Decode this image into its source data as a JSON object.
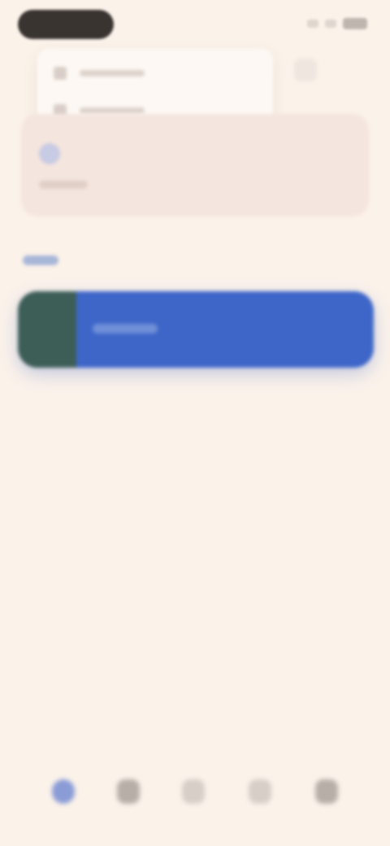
{
  "status_bar": {
    "indicator_icons": [
      "signal-icon",
      "wifi-icon",
      "battery-icon"
    ]
  },
  "menu": {
    "items": [
      {
        "icon": "menu-item-icon",
        "label": ""
      },
      {
        "icon": "menu-item-icon",
        "label": ""
      }
    ],
    "overflow_icon": "more-icon"
  },
  "suggestion_card": {
    "icon": "info-icon",
    "text": ""
  },
  "section": {
    "label": ""
  },
  "list": {
    "selected_item": {
      "thumbnail": "thumbnail-image",
      "title": ""
    },
    "accent_color": "#3e66c8"
  },
  "bottom_nav": {
    "items": [
      {
        "icon": "home-icon",
        "active": true
      },
      {
        "icon": "library-icon",
        "active": false
      },
      {
        "icon": "search-icon",
        "active": false
      },
      {
        "icon": "favorites-icon",
        "active": false
      },
      {
        "icon": "profile-icon",
        "active": false
      }
    ]
  },
  "colors": {
    "background": "#fbf2ea",
    "card": "#f4e5de",
    "accent": "#3e66c8"
  }
}
